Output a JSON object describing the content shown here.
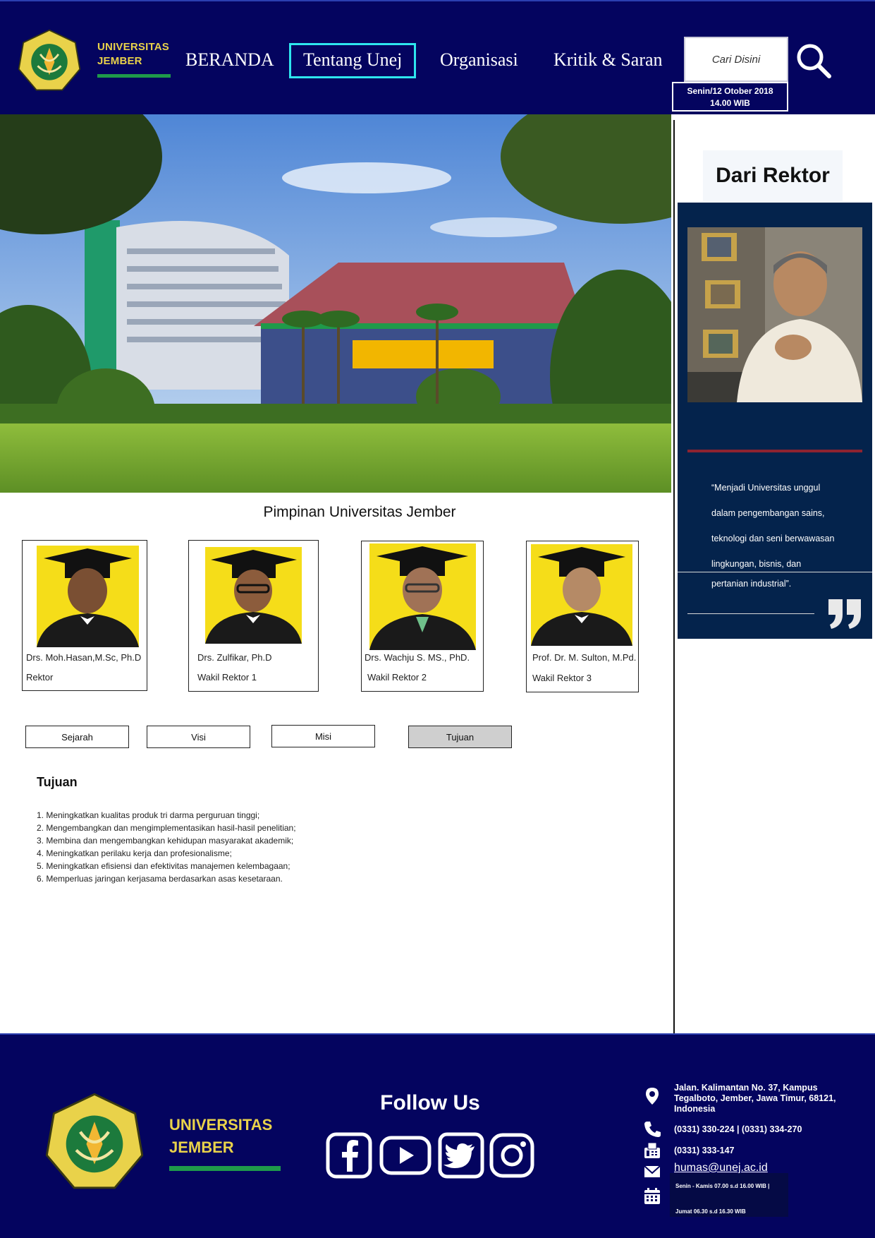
{
  "header": {
    "brand_line1": "UNIVERSITAS",
    "brand_line2": "JEMBER",
    "nav": [
      "BERANDA",
      "Tentang Unej",
      "Organisasi",
      "Kritik & Saran"
    ],
    "active_nav": "Tentang Unej",
    "search_placeholder": "Cari Disini",
    "date": "Senin/12 Otober 2018",
    "time": "14.00 WIB",
    "search_icon": "search-icon"
  },
  "sidebar": {
    "title": "Dari Rektor",
    "quote_lines": [
      "“Menjadi Universitas unggul",
      "dalam pengembangan sains,",
      "teknologi dan seni berwawasan",
      "lingkungan, bisnis, dan",
      "pertanian industrial”."
    ],
    "quote_icon": "closing-quote-icon"
  },
  "leaders": {
    "title": "Pimpinan Universitas Jember",
    "items": [
      {
        "name": "Drs. Moh.Hasan,M.Sc, Ph.D",
        "role": "Rektor"
      },
      {
        "name": "Drs. Zulfikar, Ph.D",
        "role": "Wakil Rektor 1"
      },
      {
        "name": "Drs. Wachju S. MS., PhD.",
        "role": "Wakil Rektor 2"
      },
      {
        "name": "Prof. Dr. M. Sulton, M.Pd.",
        "role": "Wakil Rektor 3"
      }
    ]
  },
  "tabs": {
    "items": [
      "Sejarah",
      "Visi",
      "Misi",
      "Tujuan"
    ],
    "active": "Tujuan"
  },
  "content": {
    "title": "Tujuan",
    "items": [
      "1. Meningkatkan kualitas produk tri darma perguruan tinggi;",
      "2. Mengembangkan dan mengimplementasikan hasil-hasil penelitian;",
      "3. Membina dan mengembangkan kehidupan masyarakat akademik;",
      "4. Meningkatkan perilaku kerja dan profesionalisme;",
      "5. Meningkatkan efisiensi dan efektivitas manajemen kelembagaan;",
      "6. Memperluas jaringan kerjasama berdasarkan asas kesetaraan."
    ]
  },
  "footer": {
    "brand_line1": "UNIVERSITAS",
    "brand_line2": "JEMBER",
    "follow_title": "Follow Us",
    "social": [
      "facebook-icon",
      "youtube-icon",
      "twitter-icon",
      "instagram-icon"
    ],
    "address": "Jalan. Kalimantan No. 37, Kampus Tegalboto, Jember, Jawa Timur, 68121, Indonesia",
    "phone": "(0331) 330-224 | (0331) 334-270",
    "fax": "(0331) 333-147",
    "email": "humas@unej.ac.id",
    "hours_line1": "Senin - Kamis 07.00 s.d 16.00 WIB |",
    "hours_line2": "Jumat 06.30 s.d 16.30 WIB"
  },
  "colors": {
    "navy": "#04045f",
    "gold": "#e9d24a",
    "green": "#1f9a4a",
    "cyan_active": "#2ee6ee",
    "rektor_card": "#04234c"
  }
}
